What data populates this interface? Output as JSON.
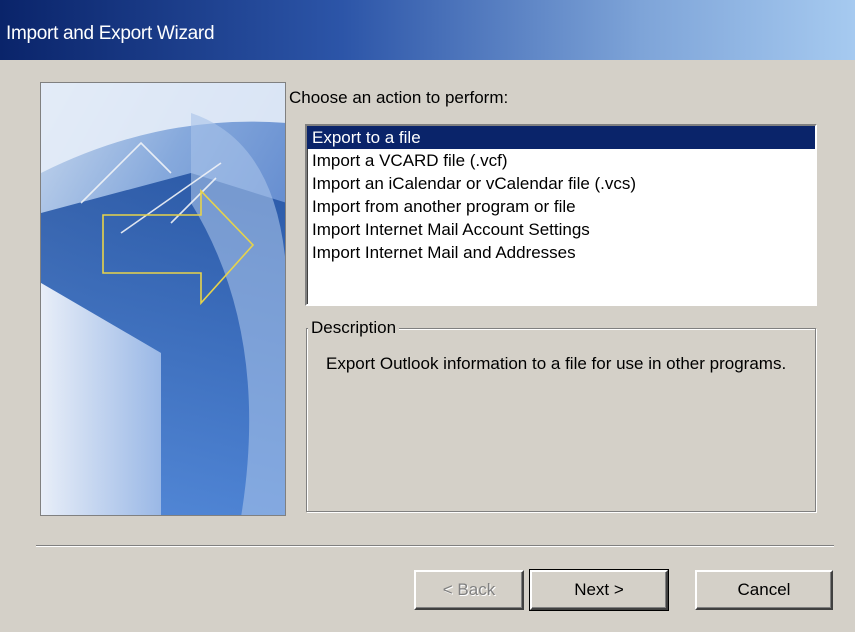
{
  "window": {
    "title": "Import and Export Wizard"
  },
  "prompt": {
    "label": "Choose an action to perform:"
  },
  "actions": [
    {
      "label": "Export to a file",
      "selected": true
    },
    {
      "label": "Import a VCARD file (.vcf)",
      "selected": false
    },
    {
      "label": "Import an iCalendar or vCalendar file (.vcs)",
      "selected": false
    },
    {
      "label": "Import from another program or file",
      "selected": false
    },
    {
      "label": "Import Internet Mail Account Settings",
      "selected": false
    },
    {
      "label": "Import Internet Mail and Addresses",
      "selected": false
    }
  ],
  "description": {
    "legend": "Description",
    "text": "Export Outlook information to a file for use in other programs."
  },
  "buttons": {
    "back": "< Back",
    "next": "Next >",
    "cancel": "Cancel"
  },
  "colors": {
    "titlebar_start": "#0a246a",
    "selection": "#0a246a",
    "dialog_face": "#d4d0c8"
  }
}
